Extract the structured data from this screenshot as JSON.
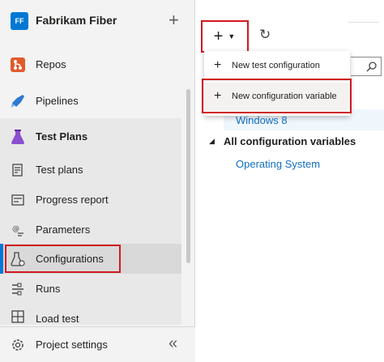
{
  "org": {
    "badge": "FF",
    "name": "Fabrikam Fiber"
  },
  "nav": {
    "repos": "Repos",
    "pipelines": "Pipelines",
    "test_plans": "Test Plans",
    "sub": {
      "test_plans": "Test plans",
      "progress_report": "Progress report",
      "parameters": "Parameters",
      "configurations": "Configurations",
      "runs": "Runs",
      "load_test": "Load test"
    },
    "project_settings": "Project settings"
  },
  "menu": {
    "new_test_configuration": "New test configuration",
    "new_configuration_variable": "New configuration variable"
  },
  "tree": {
    "windows8": "Windows 8",
    "all_vars": "All configuration variables",
    "operating_system": "Operating System"
  },
  "colors": {
    "accent": "#0078d4",
    "highlight": "#d0191f",
    "link": "#106ebe"
  }
}
